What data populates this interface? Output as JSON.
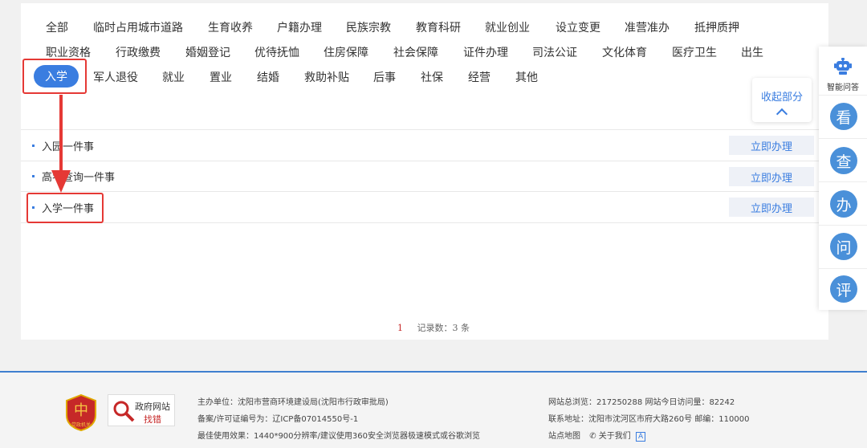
{
  "categories": {
    "row1": [
      "全部",
      "临时占用城市道路",
      "生育收养",
      "户籍办理",
      "民族宗教",
      "教育科研",
      "就业创业",
      "设立变更",
      "准营准办",
      "抵押质押"
    ],
    "row2": [
      "职业资格",
      "行政缴费",
      "婚姻登记",
      "优待抚恤",
      "住房保障",
      "社会保障",
      "证件办理",
      "司法公证",
      "文化体育",
      "医疗卫生",
      "出生"
    ],
    "row3": [
      "入学",
      "军人退役",
      "就业",
      "置业",
      "结婚",
      "救助补贴",
      "后事",
      "社保",
      "经营",
      "其他"
    ]
  },
  "collapse": {
    "label": "收起部分"
  },
  "items": [
    {
      "title": "入园一件事",
      "action": "立即办理"
    },
    {
      "title": "高考查询一件事",
      "action": "立即办理"
    },
    {
      "title": "入学一件事",
      "action": "立即办理"
    }
  ],
  "pager": {
    "page": "1",
    "count_text": "记录数：3 条"
  },
  "sidebar": {
    "robot_label": "智能问答",
    "buttons": [
      "看",
      "查",
      "办",
      "问",
      "评"
    ]
  },
  "footer": {
    "logo1_text": "党政机关",
    "logo2_line1": "政府网站",
    "logo2_line2": "找错",
    "sponsor": "主办单位：沈阳市营商环境建设局(沈阳市行政审批局)",
    "icp": "备案/许可证编号为：辽ICP备07014550号-1",
    "best": "最佳使用效果：1440*900分辨率/建议使用360安全浏览器极速模式或谷歌浏览",
    "visits": "网站总浏览：217250288  网站今日访问量：82242",
    "address": "联系地址：沈阳市沈河区市府大路260号  邮编：110000",
    "sitemap": "站点地图",
    "about": "关于我们"
  },
  "colors": {
    "accent": "#3a7de0",
    "annotation": "#e53935",
    "footer_border": "#3f7fcf"
  }
}
